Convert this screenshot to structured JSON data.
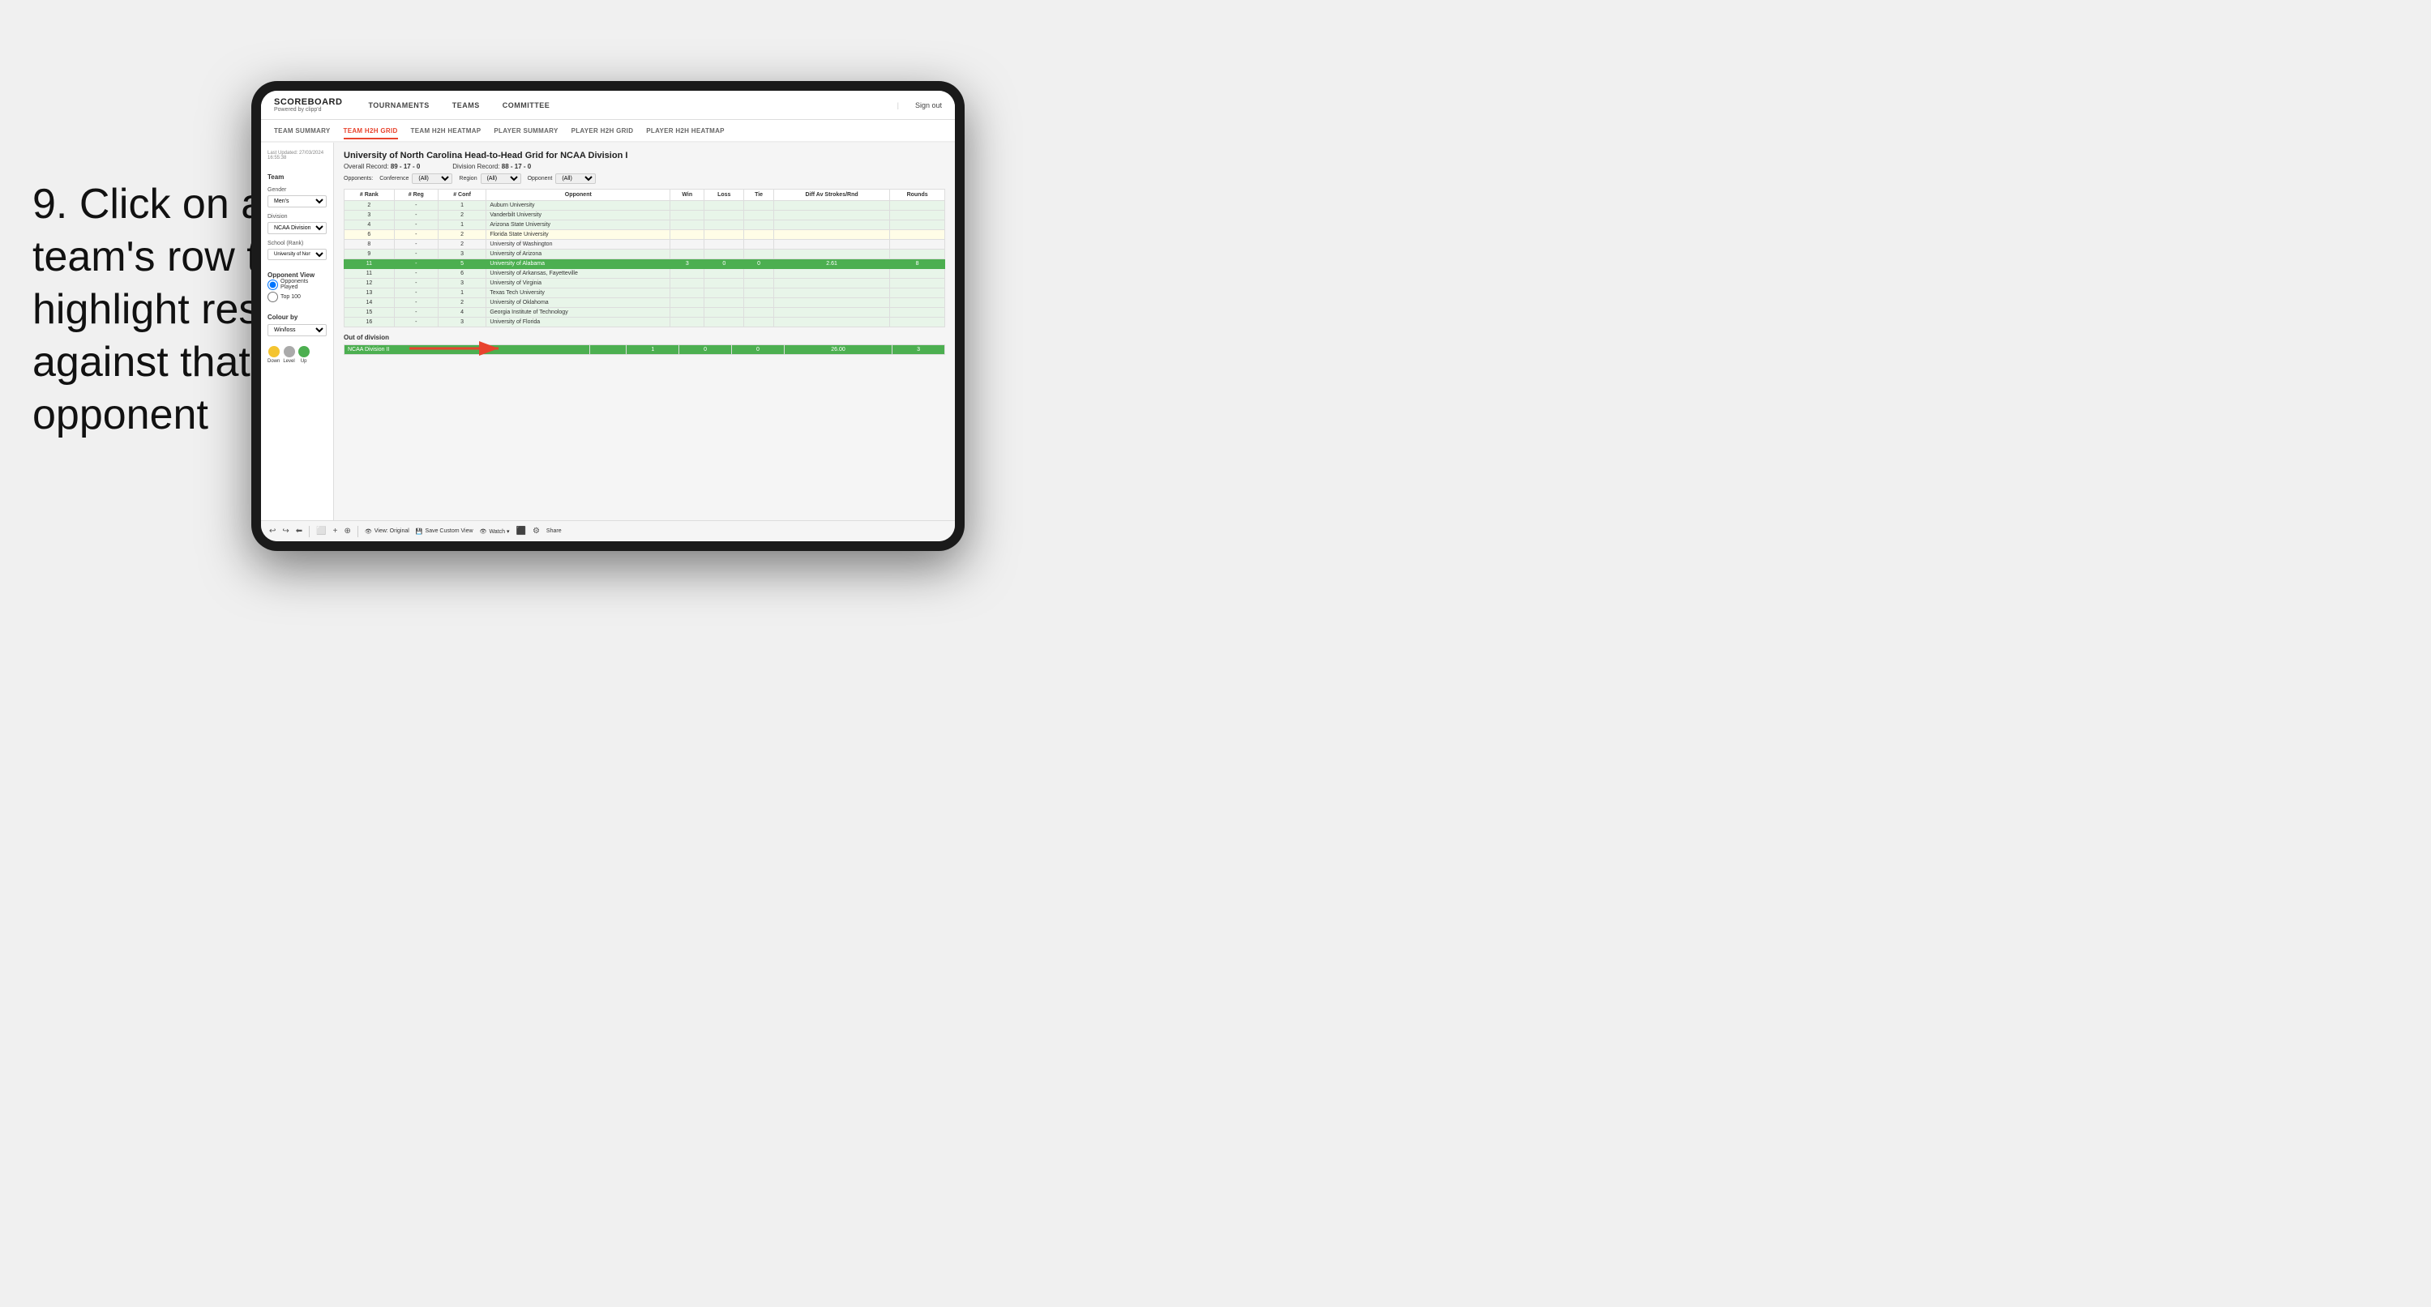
{
  "page": {
    "background": "#f0f0f0"
  },
  "instruction": {
    "step": "9.",
    "text": "Click on a team's row to highlight results against that opponent"
  },
  "nav": {
    "logo": "SCOREBOARD",
    "logo_sub": "Powered by clipp'd",
    "items": [
      "TOURNAMENTS",
      "TEAMS",
      "COMMITTEE"
    ],
    "sign_out": "Sign out"
  },
  "sub_nav": {
    "items": [
      "TEAM SUMMARY",
      "TEAM H2H GRID",
      "TEAM H2H HEATMAP",
      "PLAYER SUMMARY",
      "PLAYER H2H GRID",
      "PLAYER H2H HEATMAP"
    ],
    "active": "TEAM H2H GRID"
  },
  "sidebar": {
    "timestamp_label": "Last Updated: 27/03/2024",
    "time": "16:55:38",
    "team_label": "Team",
    "gender_label": "Gender",
    "gender_value": "Men's",
    "division_label": "Division",
    "division_value": "NCAA Division I",
    "school_label": "School (Rank)",
    "school_value": "University of Nort...",
    "opponent_view_label": "Opponent View",
    "radio_opponents": "Opponents Played",
    "radio_top100": "Top 100",
    "colour_by_label": "Colour by",
    "colour_by_value": "Win/loss",
    "legend": [
      {
        "color": "#f4c430",
        "label": "Down"
      },
      {
        "color": "#aaa",
        "label": "Level"
      },
      {
        "color": "#4caf50",
        "label": "Up"
      }
    ]
  },
  "grid": {
    "title": "University of North Carolina Head-to-Head Grid for NCAA Division I",
    "overall_record_label": "Overall Record:",
    "overall_record": "89 - 17 - 0",
    "division_record_label": "Division Record:",
    "division_record": "88 - 17 - 0",
    "filters": {
      "opponents_label": "Opponents:",
      "conference_label": "Conference",
      "conference_value": "(All)",
      "region_label": "Region",
      "region_value": "(All)",
      "opponent_label": "Opponent",
      "opponent_value": "(All)"
    },
    "columns": [
      "# Rank",
      "# Reg",
      "# Conf",
      "Opponent",
      "Win",
      "Loss",
      "Tie",
      "Diff Av Strokes/Rnd",
      "Rounds"
    ],
    "rows": [
      {
        "rank": "2",
        "reg": "-",
        "conf": "1",
        "opponent": "Auburn University",
        "win": "",
        "loss": "",
        "tie": "",
        "diff": "",
        "rounds": "",
        "style": "light-green"
      },
      {
        "rank": "3",
        "reg": "-",
        "conf": "2",
        "opponent": "Vanderbilt University",
        "win": "",
        "loss": "",
        "tie": "",
        "diff": "",
        "rounds": "",
        "style": "light-green"
      },
      {
        "rank": "4",
        "reg": "-",
        "conf": "1",
        "opponent": "Arizona State University",
        "win": "",
        "loss": "",
        "tie": "",
        "diff": "",
        "rounds": "",
        "style": "light-green"
      },
      {
        "rank": "6",
        "reg": "-",
        "conf": "2",
        "opponent": "Florida State University",
        "win": "",
        "loss": "",
        "tie": "",
        "diff": "",
        "rounds": "",
        "style": "light-yellow"
      },
      {
        "rank": "8",
        "reg": "-",
        "conf": "2",
        "opponent": "University of Washington",
        "win": "",
        "loss": "",
        "tie": "",
        "diff": "",
        "rounds": "",
        "style": ""
      },
      {
        "rank": "9",
        "reg": "-",
        "conf": "3",
        "opponent": "University of Arizona",
        "win": "",
        "loss": "",
        "tie": "",
        "diff": "",
        "rounds": "",
        "style": "light-green"
      },
      {
        "rank": "11",
        "reg": "-",
        "conf": "5",
        "opponent": "University of Alabama",
        "win": "3",
        "loss": "0",
        "tie": "0",
        "diff": "2.61",
        "rounds": "8",
        "style": "highlighted"
      },
      {
        "rank": "11",
        "reg": "-",
        "conf": "6",
        "opponent": "University of Arkansas, Fayetteville",
        "win": "",
        "loss": "",
        "tie": "",
        "diff": "",
        "rounds": "",
        "style": "light-green"
      },
      {
        "rank": "12",
        "reg": "-",
        "conf": "3",
        "opponent": "University of Virginia",
        "win": "",
        "loss": "",
        "tie": "",
        "diff": "",
        "rounds": "",
        "style": "light-green"
      },
      {
        "rank": "13",
        "reg": "-",
        "conf": "1",
        "opponent": "Texas Tech University",
        "win": "",
        "loss": "",
        "tie": "",
        "diff": "",
        "rounds": "",
        "style": "light-green"
      },
      {
        "rank": "14",
        "reg": "-",
        "conf": "2",
        "opponent": "University of Oklahoma",
        "win": "",
        "loss": "",
        "tie": "",
        "diff": "",
        "rounds": "",
        "style": "light-green"
      },
      {
        "rank": "15",
        "reg": "-",
        "conf": "4",
        "opponent": "Georgia Institute of Technology",
        "win": "",
        "loss": "",
        "tie": "",
        "diff": "",
        "rounds": "",
        "style": "light-green"
      },
      {
        "rank": "16",
        "reg": "-",
        "conf": "3",
        "opponent": "University of Florida",
        "win": "",
        "loss": "",
        "tie": "",
        "diff": "",
        "rounds": "",
        "style": "light-green"
      }
    ],
    "out_of_division_label": "Out of division",
    "out_of_division_row": {
      "label": "NCAA Division II",
      "win": "1",
      "loss": "0",
      "tie": "0",
      "diff": "26.00",
      "rounds": "3"
    }
  },
  "toolbar": {
    "undo": "↩",
    "redo": "↪",
    "back": "⬅",
    "view_original": "View: Original",
    "save_custom": "Save Custom View",
    "watch": "Watch ▾",
    "share": "Share"
  }
}
